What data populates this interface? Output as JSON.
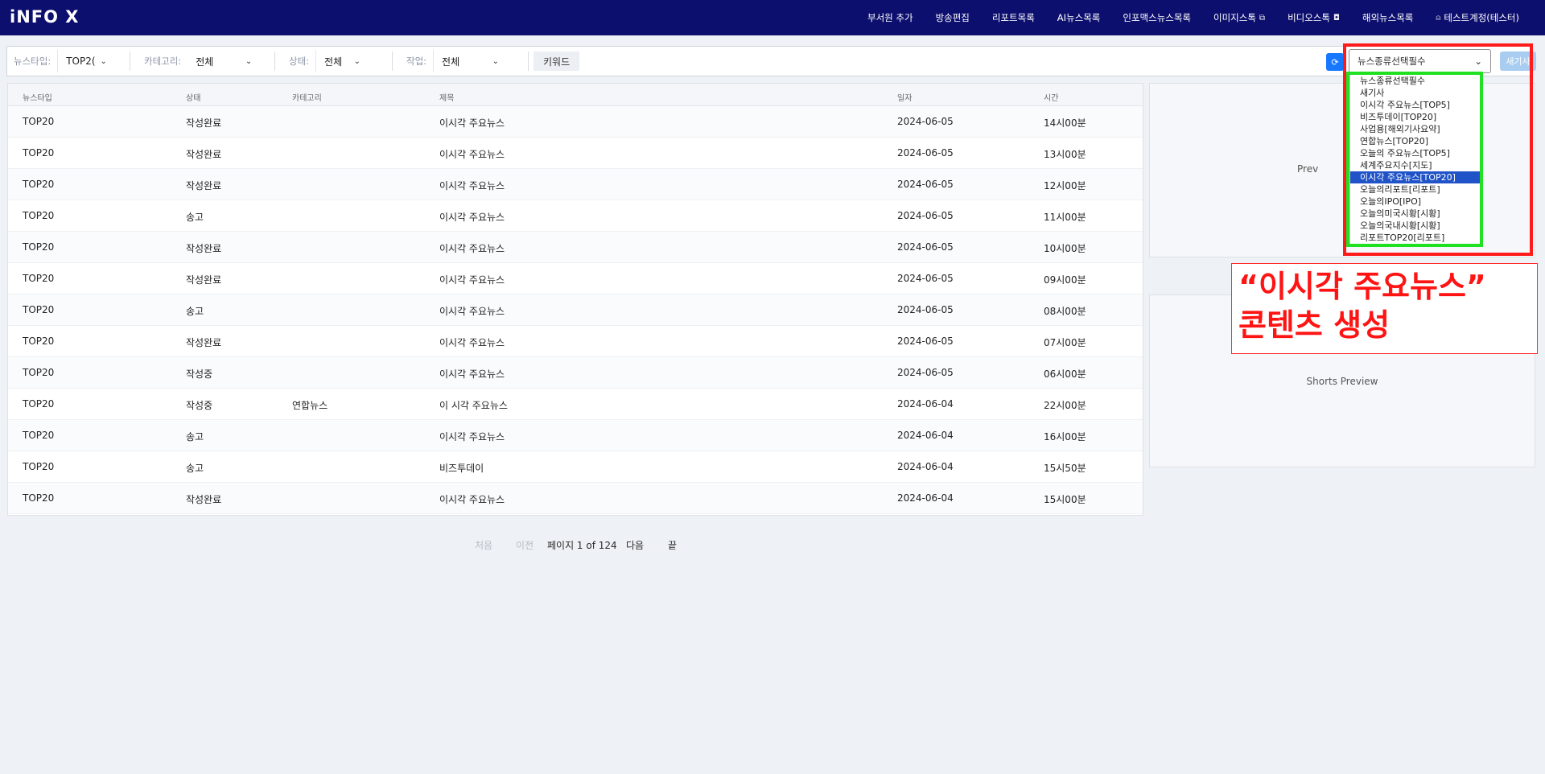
{
  "app": {
    "logo": "iNFO X"
  },
  "nav": [
    {
      "label": "부서원 추가",
      "icon": ""
    },
    {
      "label": "방송편집",
      "icon": ""
    },
    {
      "label": "리포트목록",
      "icon": ""
    },
    {
      "label": "AI뉴스목록",
      "icon": ""
    },
    {
      "label": "인포맥스뉴스목록",
      "icon": ""
    },
    {
      "label": "이미지스톡",
      "icon": "⧉"
    },
    {
      "label": "비디오스톡",
      "icon": "◘"
    },
    {
      "label": "해외뉴스목록",
      "icon": ""
    },
    {
      "label": "테스트계정(테스터)",
      "icon": "⍝"
    }
  ],
  "filters": {
    "newstype_label": "뉴스타입:",
    "newstype_value": "TOP2(",
    "category_label": "카테고리:",
    "category_value": "전체",
    "status_label": "상태:",
    "status_value": "전체",
    "job_label": "작업:",
    "job_value": "전체",
    "keyword_button": "키워드",
    "news_select_value": "뉴스종류선택필수",
    "new_button": "새기사"
  },
  "dropdown": {
    "options": [
      "뉴스종류선택필수",
      "새기사",
      "이시각 주요뉴스[TOP5]",
      "비즈투데이[TOP20]",
      "사업용[해외기사요약]",
      "연합뉴스[TOP20]",
      "오늘의 주요뉴스[TOP5]",
      "세계주요지수[지도]",
      "이시각 주요뉴스[TOP20]",
      "오늘의리포트[리포트]",
      "오늘의IPO[IPO]",
      "오늘의미국시황[시황]",
      "오늘의국내시황[시황]",
      "리포트TOP20[리포트]"
    ],
    "selected_index": 8
  },
  "callout": {
    "line1": "“이시각 주요뉴스”",
    "line2": "콘텐츠 생성"
  },
  "table": {
    "headers": {
      "newstype": "뉴스타입",
      "status": "상태",
      "category": "카테고리",
      "title": "제목",
      "date": "일자",
      "time": "시간"
    },
    "rows": [
      {
        "newstype": "TOP20",
        "status": "작성완료",
        "category": "",
        "title": "이시각 주요뉴스",
        "date": "2024-06-05",
        "time": "14시00분"
      },
      {
        "newstype": "TOP20",
        "status": "작성완료",
        "category": "",
        "title": "이시각 주요뉴스",
        "date": "2024-06-05",
        "time": "13시00분"
      },
      {
        "newstype": "TOP20",
        "status": "작성완료",
        "category": "",
        "title": "이시각 주요뉴스",
        "date": "2024-06-05",
        "time": "12시00분"
      },
      {
        "newstype": "TOP20",
        "status": "송고",
        "category": "",
        "title": "이시각 주요뉴스",
        "date": "2024-06-05",
        "time": "11시00분"
      },
      {
        "newstype": "TOP20",
        "status": "작성완료",
        "category": "",
        "title": "이시각 주요뉴스",
        "date": "2024-06-05",
        "time": "10시00분"
      },
      {
        "newstype": "TOP20",
        "status": "작성완료",
        "category": "",
        "title": "이시각 주요뉴스",
        "date": "2024-06-05",
        "time": "09시00분"
      },
      {
        "newstype": "TOP20",
        "status": "송고",
        "category": "",
        "title": "이시각 주요뉴스",
        "date": "2024-06-05",
        "time": "08시00분"
      },
      {
        "newstype": "TOP20",
        "status": "작성완료",
        "category": "",
        "title": "이시각 주요뉴스",
        "date": "2024-06-05",
        "time": "07시00분"
      },
      {
        "newstype": "TOP20",
        "status": "작성중",
        "category": "",
        "title": "이시각 주요뉴스",
        "date": "2024-06-05",
        "time": "06시00분"
      },
      {
        "newstype": "TOP20",
        "status": "작성중",
        "category": "연합뉴스",
        "title": "이 시각 주요뉴스",
        "date": "2024-06-04",
        "time": "22시00분"
      },
      {
        "newstype": "TOP20",
        "status": "송고",
        "category": "",
        "title": "이시각 주요뉴스",
        "date": "2024-06-04",
        "time": "16시00분"
      },
      {
        "newstype": "TOP20",
        "status": "송고",
        "category": "",
        "title": "비즈투데이",
        "date": "2024-06-04",
        "time": "15시50분"
      },
      {
        "newstype": "TOP20",
        "status": "작성완료",
        "category": "",
        "title": "이시각 주요뉴스",
        "date": "2024-06-04",
        "time": "15시00분"
      }
    ]
  },
  "pager": {
    "first": "처음",
    "prev": "이전",
    "info": "페이지 1 of 124",
    "next": "다음",
    "last": "끝"
  },
  "panels": {
    "preview": "Prev",
    "shorts": "Shorts Preview"
  }
}
